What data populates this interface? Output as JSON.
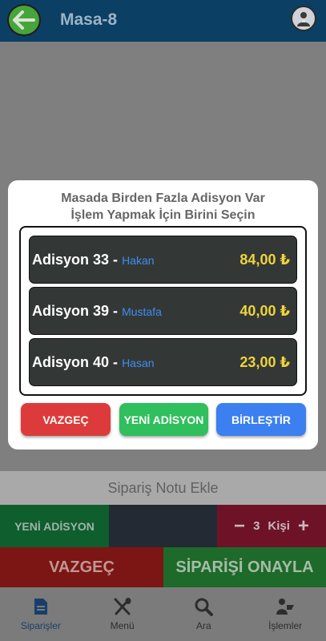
{
  "appbar": {
    "title": "Masa-8",
    "back_icon": "arrow-left-icon",
    "profile_icon": "waiter-avatar-icon"
  },
  "dialog": {
    "title_line1": "Masada Birden Fazla Adisyon Var",
    "title_line2": "İşlem Yapmak İçin Birini Seçin",
    "adisyons": [
      {
        "name": "Adisyon 33",
        "waiter": "Hakan",
        "amount": "84,00 ₺"
      },
      {
        "name": "Adisyon 39",
        "waiter": "Mustafa",
        "amount": "40,00 ₺"
      },
      {
        "name": "Adisyon 40",
        "waiter": "Hasan",
        "amount": "23,00 ₺"
      }
    ],
    "separator": "-",
    "buttons": {
      "cancel": "VAZGEÇ",
      "new": "YENİ ADİSYON",
      "merge": "BİRLEŞTİR"
    }
  },
  "order_panel": {
    "note_label": "Sipariş Notu Ekle",
    "new_adisyon": "YENİ ADİSYON",
    "minus": "−",
    "person_count": "3",
    "person_label": "Kişi",
    "plus": "+",
    "cancel": "VAZGEÇ",
    "confirm": "SİPARİŞİ ONAYLA"
  },
  "bottomnav": [
    {
      "label": "Siparişler",
      "icon": "document-icon",
      "active": true
    },
    {
      "label": "Menü",
      "icon": "utensils-icon",
      "active": false
    },
    {
      "label": "Ara",
      "icon": "search-icon",
      "active": false
    },
    {
      "label": "İşlemler",
      "icon": "operations-icon",
      "active": false
    }
  ],
  "colors": {
    "appbar": "#0b3f64",
    "accent_green": "#2fbf5c",
    "accent_red": "#dd3b3b",
    "accent_blue": "#3b7ff0",
    "amount_yellow": "#f0d339",
    "waiter_blue": "#3f8df2"
  }
}
